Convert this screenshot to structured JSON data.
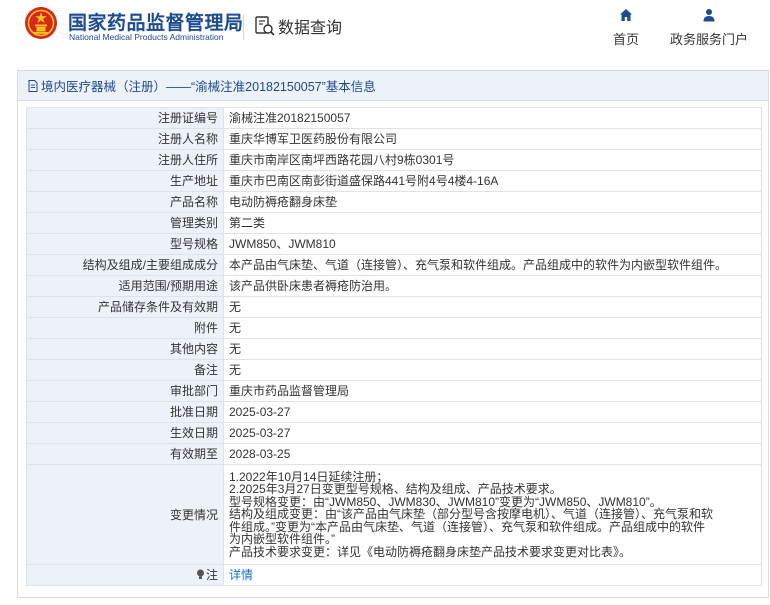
{
  "header": {
    "brand_cn": "国家药品监督管理局",
    "brand_en": "National Medical Products Administration",
    "query_label": "数据查询",
    "nav": {
      "home": "首页",
      "portal": "政务服务门户"
    }
  },
  "panel": {
    "title": "境内医疗器械（注册）——“渝械注准20182150057”基本信息"
  },
  "rows": [
    {
      "label": "注册证编号",
      "value": "渝械注准20182150057"
    },
    {
      "label": "注册人名称",
      "value": "重庆华博军卫医药股份有限公司"
    },
    {
      "label": "注册人住所",
      "value": "重庆市南岸区南坪西路花园八村9栋0301号"
    },
    {
      "label": "生产地址",
      "value": "重庆市巴南区南彭街道盛保路441号附4号4楼4-16A"
    },
    {
      "label": "产品名称",
      "value": "电动防褥疮翻身床垫"
    },
    {
      "label": "管理类别",
      "value": "第二类"
    },
    {
      "label": "型号规格",
      "value": "JWM850、JWM810"
    },
    {
      "label": "结构及组成/主要组成成分",
      "value": "本产品由气床垫、气道（连接管）、充气泵和软件组成。产品组成中的软件为内嵌型软件组件。"
    },
    {
      "label": "适用范围/预期用途",
      "value": "该产品供卧床患者褥疮防治用。"
    },
    {
      "label": "产品储存条件及有效期",
      "value": "无"
    },
    {
      "label": "附件",
      "value": "无"
    },
    {
      "label": "其他内容",
      "value": "无"
    },
    {
      "label": "备注",
      "value": "无"
    },
    {
      "label": "审批部门",
      "value": "重庆市药品监督管理局"
    },
    {
      "label": "批准日期",
      "value": "2025-03-27"
    },
    {
      "label": "生效日期",
      "value": "2025-03-27"
    },
    {
      "label": "有效期至",
      "value": "2028-03-25"
    }
  ],
  "changes": {
    "label": "变更情况",
    "lines": [
      "1.2022年10月14日延续注册；",
      "2.2025年3月27日变更型号规格、结构及组成、产品技术要求。",
      "型号规格变更：由“JWM850、JWM830、JWM810”变更为“JWM850、JWM810”。",
      "结构及组成变更：由“该产品由气床垫（部分型号含按摩电机）、气道（连接管）、充气泵和软",
      "件组成。”变更为“本产品由气床垫、气道（连接管）、充气泵和软件组成。产品组成中的软件",
      "为内嵌型软件组件。”",
      "产品技术要求变更：详见《电动防褥疮翻身床垫产品技术要求变更对比表》。"
    ]
  },
  "detail": {
    "label": "注",
    "link": "详情"
  },
  "colors": {
    "brand_blue": "#1a4b93",
    "label_bg": "#edf2f8",
    "link": "#1a6fc9",
    "emblem_red": "#d7261e",
    "emblem_gold": "#f5c518"
  },
  "icons": {
    "emblem": "national-emblem-icon",
    "query": "document-search-icon",
    "home": "home-icon",
    "portal": "user-icon",
    "doc": "document-icon",
    "tip": "lightbulb-icon"
  }
}
